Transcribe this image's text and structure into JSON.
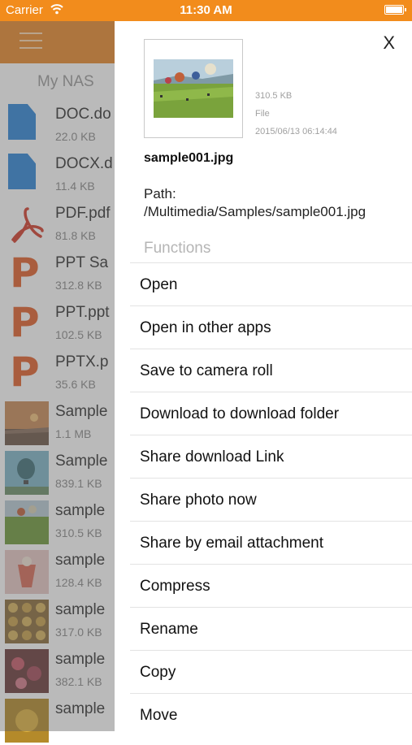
{
  "status_bar": {
    "carrier": "Carrier",
    "time": "11:30 AM",
    "wifi_icon": "wifi-icon",
    "battery_icon": "battery-icon",
    "color": "#f28c1c"
  },
  "background": {
    "title": "My NAS",
    "nav_color": "#e8892a",
    "files": [
      {
        "name": "DOC.do",
        "size": "22.0 KB",
        "icon": "doc"
      },
      {
        "name": "DOCX.d",
        "size": "11.4 KB",
        "icon": "doc"
      },
      {
        "name": "PDF.pdf",
        "size": "81.8 KB",
        "icon": "pdf"
      },
      {
        "name": "PPT Sa",
        "size": "312.8 KB",
        "icon": "ppt"
      },
      {
        "name": "PPT.ppt",
        "size": "102.5 KB",
        "icon": "ppt"
      },
      {
        "name": "PPTX.p",
        "size": "35.6 KB",
        "icon": "ppt"
      },
      {
        "name": "Sample",
        "size": "1.1 MB",
        "icon": "photo"
      },
      {
        "name": "Sample",
        "size": "839.1 KB",
        "icon": "photo"
      },
      {
        "name": "sample",
        "size": "310.5 KB",
        "icon": "photo"
      },
      {
        "name": "sample",
        "size": "128.4 KB",
        "icon": "photo"
      },
      {
        "name": "sample",
        "size": "317.0 KB",
        "icon": "photo"
      },
      {
        "name": "sample",
        "size": "382.1 KB",
        "icon": "photo"
      },
      {
        "name": "sample",
        "size": "",
        "icon": "photo"
      }
    ]
  },
  "drawer": {
    "close_label": "X",
    "file": {
      "size": "310.5 KB",
      "type": "File",
      "date": "2015/06/13 06:14:44",
      "name": "sample001.jpg",
      "path": "Path: /Multimedia/Samples/sample001.jpg"
    },
    "section_title": "Functions",
    "functions": [
      "Open",
      "Open in other apps",
      "Save to camera roll",
      "Download to download folder",
      "Share download Link",
      "Share photo now",
      "Share by email attachment",
      "Compress",
      "Rename",
      "Copy",
      "Move"
    ]
  }
}
